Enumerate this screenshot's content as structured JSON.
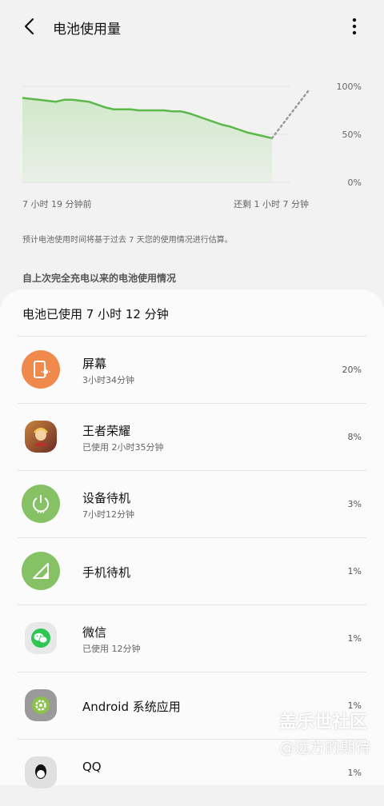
{
  "header": {
    "title": "电池使用量",
    "back_icon": "back-arrow-icon",
    "more_icon": "more-vertical-icon"
  },
  "chart_data": {
    "type": "area",
    "x_start_label": "7 小时 19 分钟前",
    "x_end_label": "还剩 1 小时 7 分钟",
    "y_ticks": [
      "100%",
      "50%",
      "0%"
    ],
    "ylim": [
      0,
      100
    ],
    "history_percent": [
      88,
      87,
      86,
      85,
      84,
      86,
      86,
      85,
      84,
      81,
      78,
      76,
      76,
      76,
      75,
      75,
      75,
      75,
      74,
      74,
      72,
      69,
      66,
      63,
      60,
      58,
      55,
      52,
      50,
      48,
      46
    ],
    "projection_percent": [
      46,
      96
    ],
    "colors": {
      "line": "#5cb84a",
      "fill": "#cfe8c8",
      "projection": "#9a9a9a"
    }
  },
  "note": "预计电池使用时间将基于过去 7 天您的使用情况进行估算。",
  "section_title": "自上次完全充电以来的电池使用情况",
  "battery_used": "电池已使用 7 小时 12 分钟",
  "apps": [
    {
      "name": "屏幕",
      "sub": "3小时34分钟",
      "percent": "20%",
      "icon": "screen-brightness-icon",
      "color": "#ef8a4c"
    },
    {
      "name": "王者荣耀",
      "sub": "已使用 2小时35分钟",
      "percent": "8%",
      "icon": "honor-of-kings-app-icon",
      "color": "#7a3f2a"
    },
    {
      "name": "设备待机",
      "sub": "7小时12分钟",
      "percent": "3%",
      "icon": "power-standby-icon",
      "color": "#86c165"
    },
    {
      "name": "手机待机",
      "sub": "",
      "percent": "1%",
      "icon": "cell-signal-icon",
      "color": "#86c165"
    },
    {
      "name": "微信",
      "sub": "已使用 12分钟",
      "percent": "1%",
      "icon": "wechat-app-icon",
      "color": "#2dc653"
    },
    {
      "name": "Android 系统应用",
      "sub": "",
      "percent": "1%",
      "icon": "android-system-gear-icon",
      "color": "#8bc34a"
    },
    {
      "name": "QQ",
      "sub": "",
      "percent": "1%",
      "icon": "qq-app-icon",
      "color": "#f5c518"
    }
  ],
  "watermark": {
    "line1": "盖乐世社区",
    "line2": "@远方的期待"
  }
}
